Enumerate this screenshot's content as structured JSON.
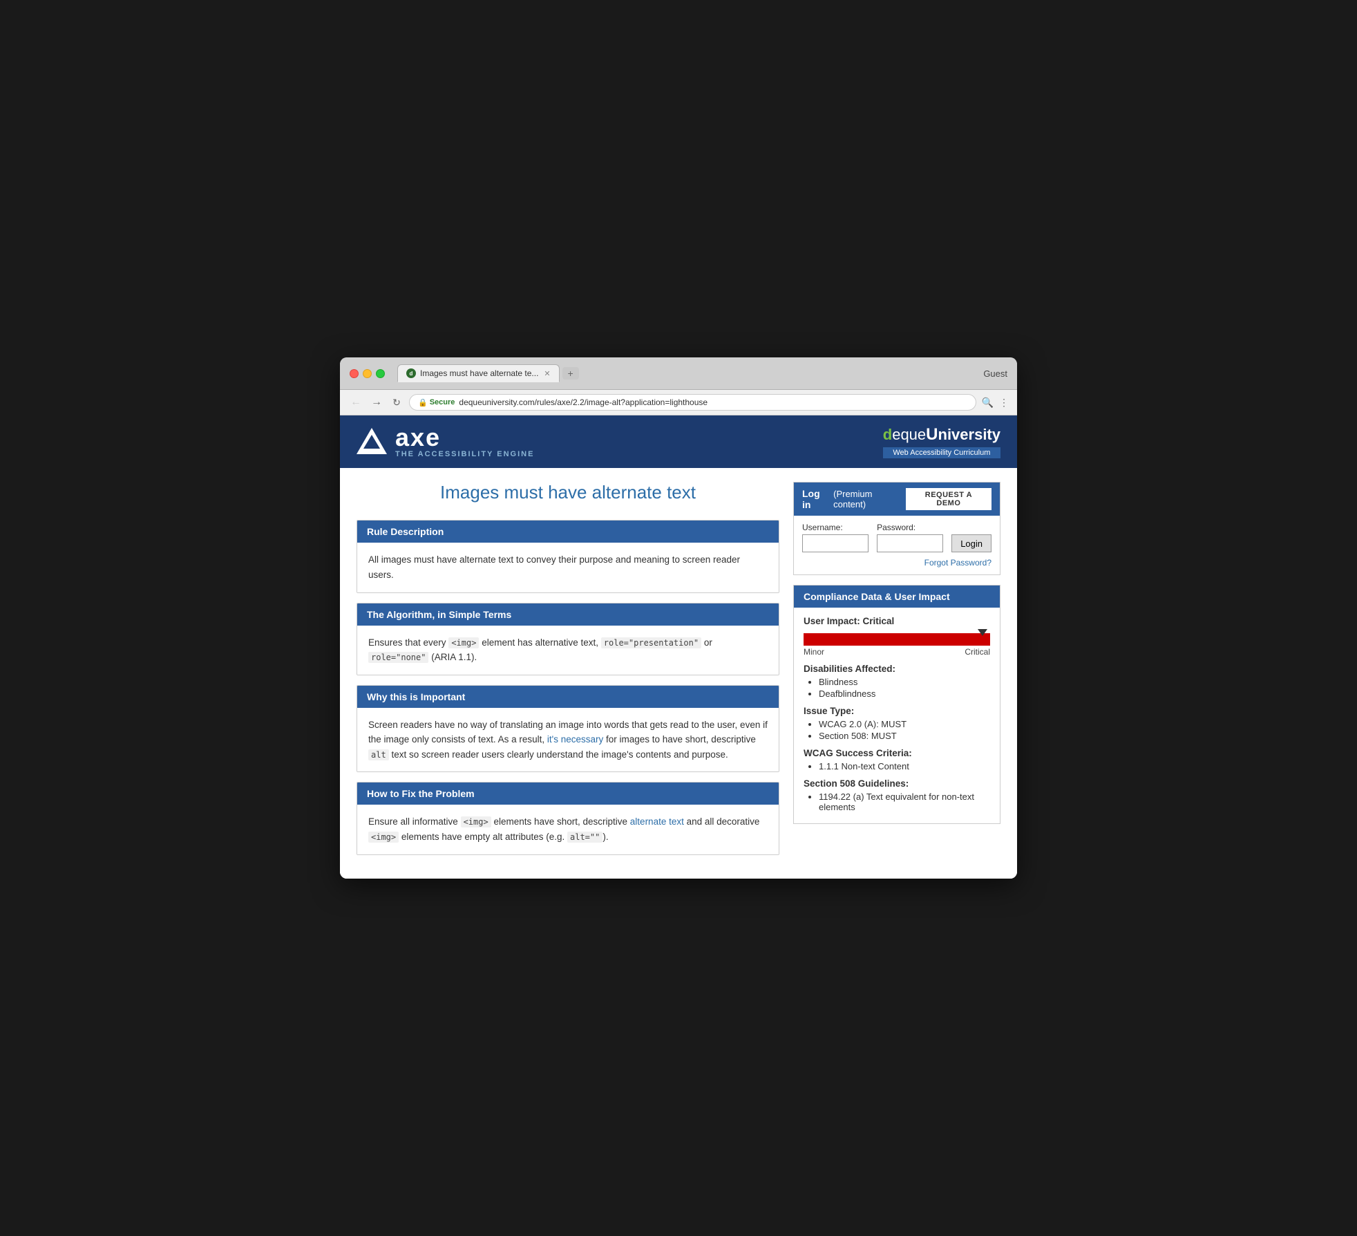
{
  "browser": {
    "tab_title": "Images must have alternate te...",
    "tab_icon": "d",
    "guest_label": "Guest",
    "url_secure_label": "Secure",
    "url": "https://dequeuniversity.com/rules/axe/2.2/image-alt?application=lighthouse",
    "url_domain": "dequeuniversity.com",
    "url_path": "/rules/axe/2.2/image-alt?application=lighthouse"
  },
  "header": {
    "logo_tagline": "THE ACCESSIBILITY ENGINE",
    "axe_text": "axe",
    "deque_name_part1": "deque",
    "deque_name_part2": "University",
    "deque_subtitle": "Web Accessibility Curriculum"
  },
  "page": {
    "title": "Images must have alternate text"
  },
  "rule_description": {
    "heading": "Rule Description",
    "body": "All images must have alternate text to convey their purpose and meaning to screen reader users."
  },
  "algorithm_section": {
    "heading": "The Algorithm, in Simple Terms",
    "body_plain": "Ensures that every  element has alternative text,  or  (ARIA 1.1).",
    "body_full": "Ensures that every <img> element has alternative text, role=\"presentation\" or role=\"none\" (ARIA 1.1)."
  },
  "why_important": {
    "heading": "Why this is Important",
    "body": "Screen readers have no way of translating an image into words that gets read to the user, even if the image only consists of text. As a result, it's necessary for images to have short, descriptive alt text so screen reader users clearly understand the image's contents and purpose."
  },
  "how_to_fix": {
    "heading": "How to Fix the Problem",
    "body": "Ensure all informative <img> elements have short, descriptive alternate text and all decorative <img> elements have empty alt attributes (e.g. alt=\"\")."
  },
  "login_box": {
    "title": "Log in",
    "subtitle": "(Premium content)",
    "request_demo_label": "REQUEST A DEMO",
    "username_label": "Username:",
    "password_label": "Password:",
    "login_btn_label": "Login",
    "forgot_password_label": "Forgot Password?"
  },
  "compliance": {
    "heading": "Compliance Data & User Impact",
    "user_impact_label": "User Impact: Critical",
    "impact_bar_min": "Minor",
    "impact_bar_max": "Critical",
    "disabilities_heading": "Disabilities Affected:",
    "disabilities": [
      "Blindness",
      "Deafblindness"
    ],
    "issue_type_heading": "Issue Type:",
    "issue_types": [
      "WCAG 2.0 (A): MUST",
      "Section 508: MUST"
    ],
    "wcag_heading": "WCAG Success Criteria:",
    "wcag_items": [
      "1.1.1 Non-text Content"
    ],
    "section508_heading": "Section 508 Guidelines:",
    "section508_items": [
      "1194.22 (a) Text equivalent for non-text elements"
    ]
  }
}
